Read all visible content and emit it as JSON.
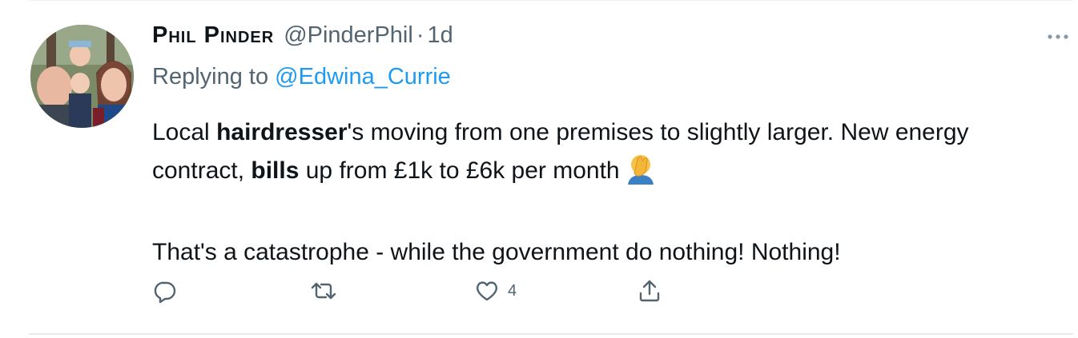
{
  "tweet": {
    "author_name": "Phil Pinder",
    "handle": "@PinderPhil",
    "separator": "·",
    "time": "1d",
    "replying_prefix": "Replying to",
    "replying_to": "@Edwina_Currie",
    "p1_a": "Local ",
    "p1_b": "hairdresser",
    "p1_c": "'s moving from one premises to slightly larger. New energy contract, ",
    "p1_d": "bills",
    "p1_e": " up from £1k to £6k per month",
    "p2": "That's a catastrophe - while the government do nothing! Nothing!",
    "emoji": "person-facepalming-emoji",
    "likes": "4"
  },
  "icons": {
    "more": "more-dots-icon",
    "reply": "reply-icon",
    "retweet": "retweet-icon",
    "like": "heart-icon",
    "share": "share-icon"
  },
  "colors": {
    "link": "#1d9bf0",
    "secondary": "#536471",
    "text": "#0f1419"
  }
}
